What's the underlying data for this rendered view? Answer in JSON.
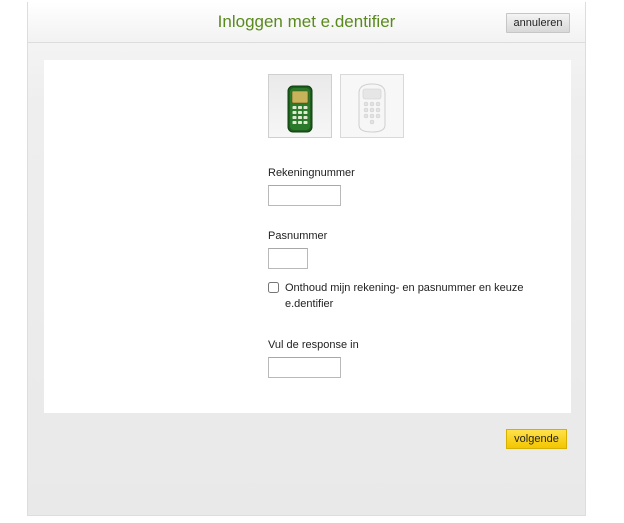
{
  "header": {
    "title": "Inloggen met e.dentifier",
    "cancel_label": "annuleren"
  },
  "device_selector": {
    "options": [
      {
        "icon": "green-edentifier-icon",
        "selected": true
      },
      {
        "icon": "white-edentifier-icon",
        "selected": false
      }
    ]
  },
  "form": {
    "account_number": {
      "label": "Rekeningnummer",
      "value": ""
    },
    "card_number": {
      "label": "Pasnummer",
      "value": ""
    },
    "remember": {
      "label": "Onthoud mijn rekening- en pasnummer en keuze e.dentifier",
      "checked": false
    },
    "response": {
      "label": "Vul de response in",
      "value": ""
    }
  },
  "footer": {
    "next_label": "volgende"
  },
  "colors": {
    "title": "#5a8a1e",
    "next_button": "#ffd400",
    "device_green": "#1f6b1f"
  }
}
